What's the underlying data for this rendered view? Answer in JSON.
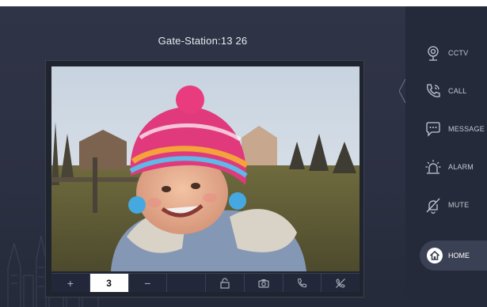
{
  "station": {
    "title": "Gate-Station:13 26"
  },
  "toolbar": {
    "plus_label": "+",
    "number_value": "3",
    "minus_label": "−"
  },
  "sidebar": {
    "items": [
      {
        "label": "CCTV",
        "icon": "camera-icon"
      },
      {
        "label": "CALL",
        "icon": "phone-icon"
      },
      {
        "label": "MESSAGE",
        "icon": "message-icon"
      },
      {
        "label": "ALARM",
        "icon": "alarm-icon"
      },
      {
        "label": "MUTE",
        "icon": "mute-icon"
      }
    ],
    "home": {
      "label": "HOME",
      "icon": "home-icon"
    }
  },
  "colors": {
    "background": "#2b3042",
    "side_panel": "#252a3a",
    "home_button": "#3a4154",
    "text": "#c4c8d4"
  }
}
